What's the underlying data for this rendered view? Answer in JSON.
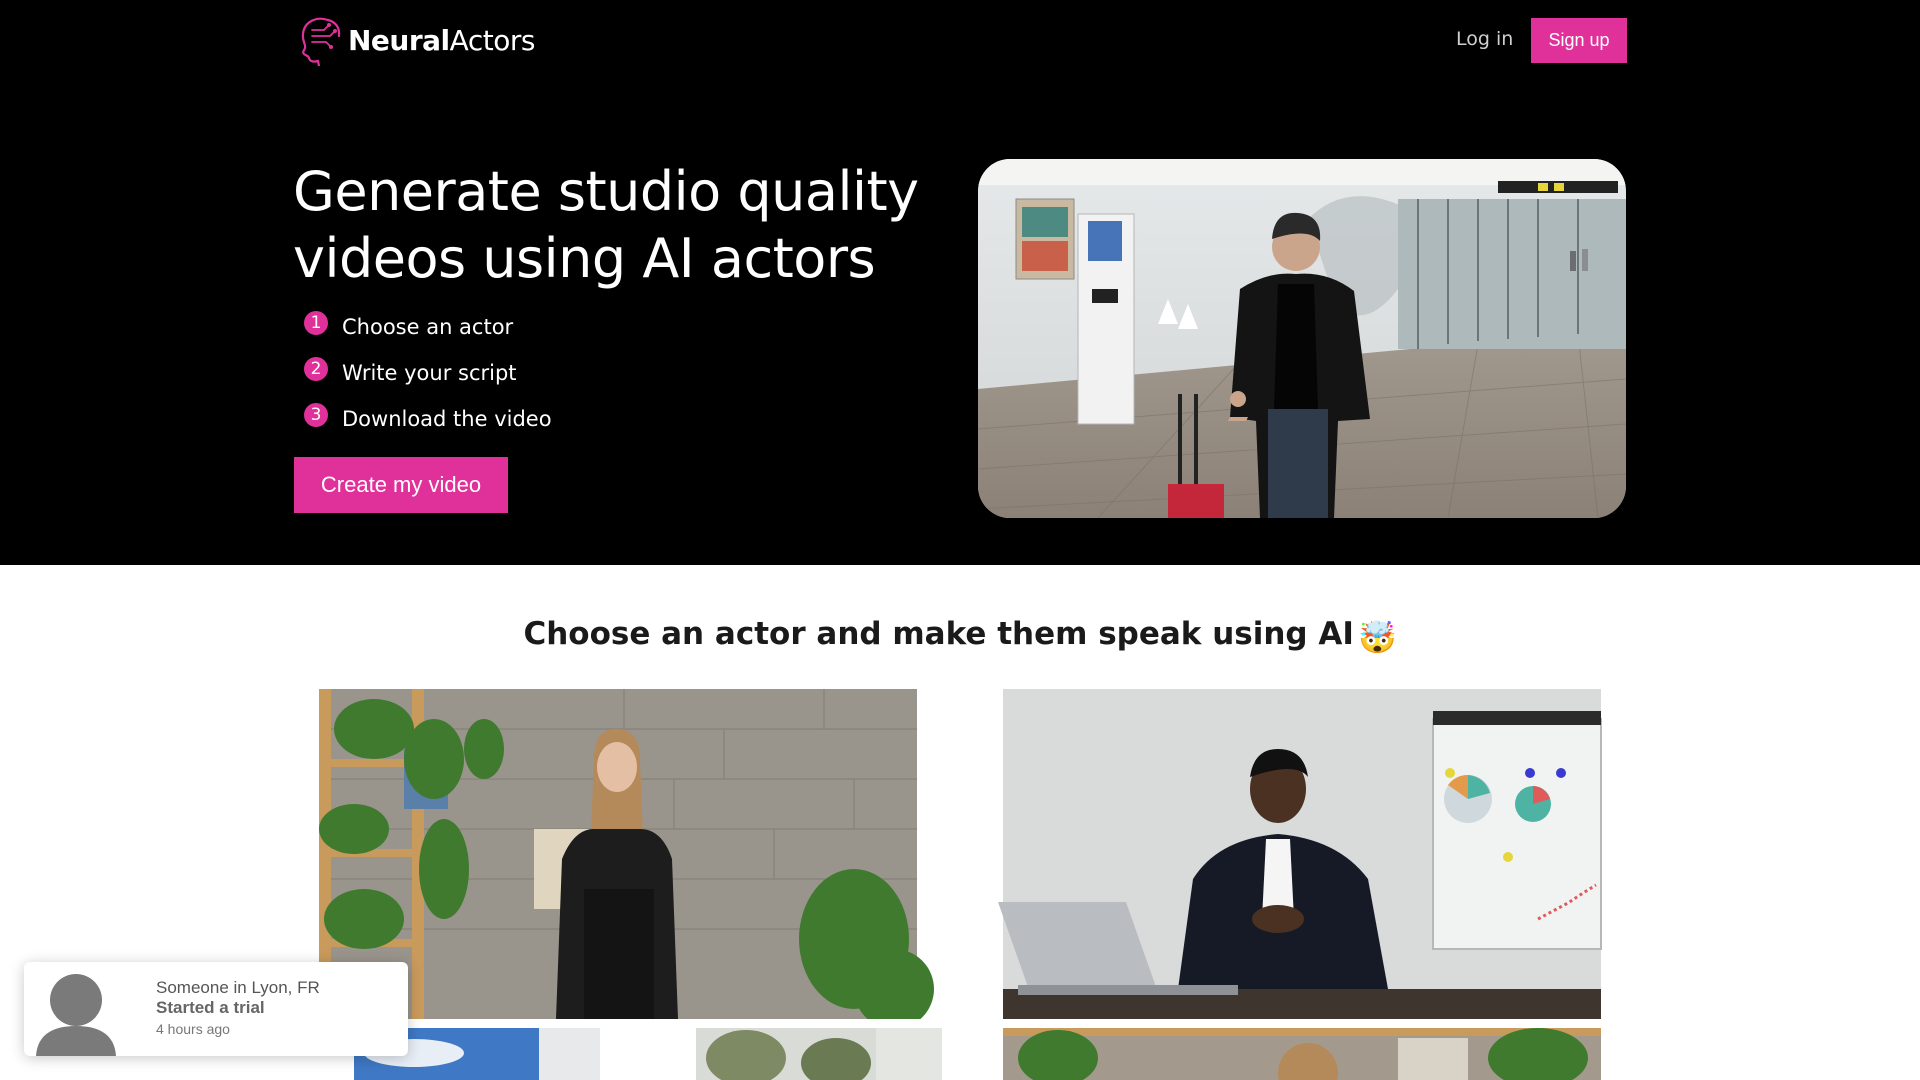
{
  "header": {
    "brand_bold": "Neural",
    "brand_light": "Actors",
    "login_label": "Log in",
    "signup_label": "Sign up"
  },
  "hero": {
    "title": "Generate studio quality videos using AI actors",
    "steps": [
      {
        "number": "1",
        "label": "Choose an actor"
      },
      {
        "number": "2",
        "label": "Write your script"
      },
      {
        "number": "3",
        "label": "Download the video"
      }
    ],
    "cta_label": "Create my video"
  },
  "actors_section": {
    "title": "Choose an actor and make them speak using AI",
    "emoji": "🤯"
  },
  "notification": {
    "line1": "Someone in Lyon, FR",
    "line2": "Started a trial",
    "line3": "4 hours ago"
  },
  "colors": {
    "accent": "#e0319b",
    "hero_background": "#000000"
  }
}
